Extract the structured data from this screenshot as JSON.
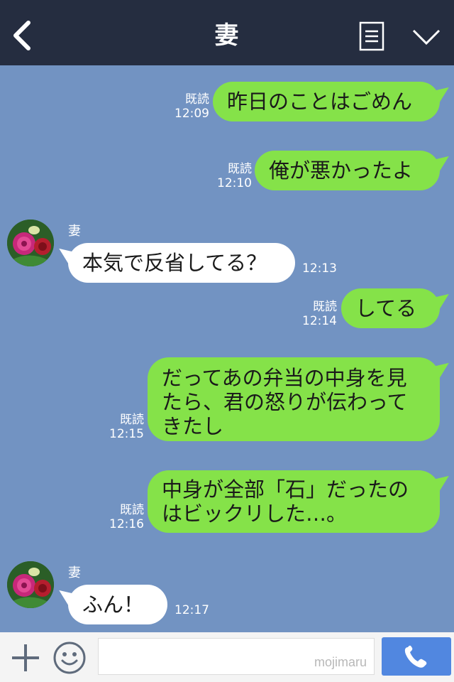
{
  "header": {
    "title": "妻",
    "back_icon": "chevron-left-icon",
    "menu_icon": "list-icon",
    "dropdown_icon": "chevron-down-icon"
  },
  "read_label": "既読",
  "messages": [
    {
      "dir": "out",
      "text": "昨日のことはごめん",
      "time": "12:09"
    },
    {
      "dir": "out",
      "text": "俺が悪かったよ",
      "time": "12:10"
    },
    {
      "dir": "in",
      "sender": "妻",
      "text": "本気で反省してる？",
      "time": "12:13"
    },
    {
      "dir": "out",
      "text": "してる",
      "time": "12:14"
    },
    {
      "dir": "out",
      "lines": [
        "だってあの弁当の中身を見",
        "たら、君の怒りが伝わって",
        "きたし"
      ],
      "time": "12:15"
    },
    {
      "dir": "out",
      "lines": [
        "中身が全部「石」だったの",
        "はビックリした…。"
      ],
      "time": "12:16"
    },
    {
      "dir": "in",
      "sender": "妻",
      "text": "ふん！",
      "time": "12:17"
    }
  ],
  "footer": {
    "input_placeholder": "",
    "watermark": "mojimaru",
    "plus_icon": "plus-icon",
    "emoji_icon": "smiley-icon",
    "call_icon": "phone-icon"
  },
  "colors": {
    "header_bg": "#252d40",
    "chat_bg": "#7293c2",
    "outgoing_bubble": "#85e249",
    "incoming_bubble": "#ffffff",
    "call_button": "#5187e0"
  }
}
